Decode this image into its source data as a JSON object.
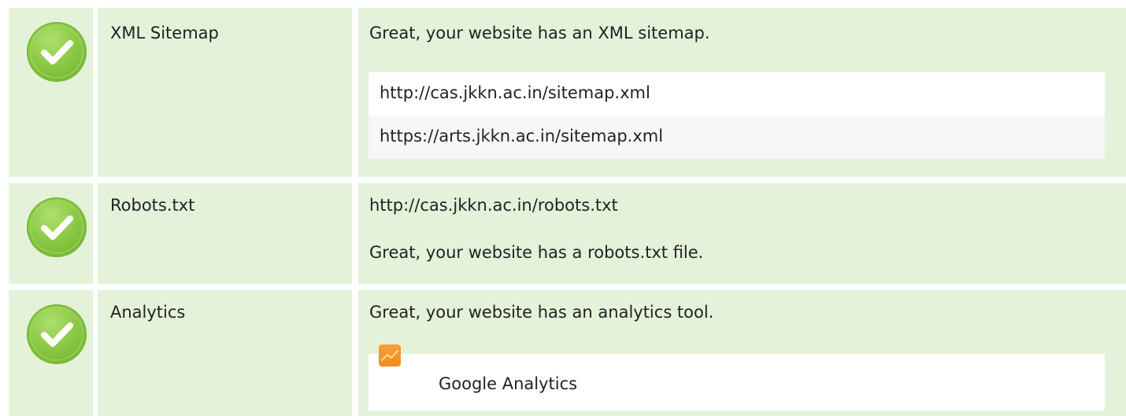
{
  "rows": [
    {
      "label": "XML Sitemap",
      "message": "Great, your website has an XML sitemap.",
      "urls": [
        "http://cas.jkkn.ac.in/sitemap.xml",
        "https://arts.jkkn.ac.in/sitemap.xml"
      ]
    },
    {
      "label": "Robots.txt",
      "url": "http://cas.jkkn.ac.in/robots.txt",
      "message": "Great, your website has a robots.txt file."
    },
    {
      "label": "Analytics",
      "message": "Great, your website has an analytics tool.",
      "tools": [
        "Google Analytics"
      ]
    }
  ],
  "icons": {
    "status": "check-icon",
    "analytics_tool": "google-analytics-icon"
  },
  "colors": {
    "row_background": "#e4f2da",
    "check_green": "#86c441",
    "analytics_orange": "#f18a1e"
  }
}
